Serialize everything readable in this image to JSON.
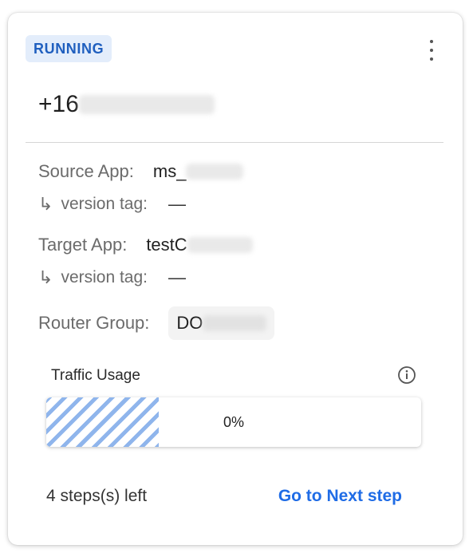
{
  "status": "RUNNING",
  "phone_prefix": "+16",
  "source_app": {
    "label": "Source App:",
    "value_prefix": "ms_"
  },
  "source_version": {
    "label": "version tag:",
    "value": "—"
  },
  "target_app": {
    "label": "Target App:",
    "value_prefix": "testC"
  },
  "target_version": {
    "label": "version tag:",
    "value": "—"
  },
  "router_group": {
    "label": "Router Group:",
    "value_prefix": "DO"
  },
  "traffic": {
    "title": "Traffic Usage",
    "percent_text": "0%",
    "fill_fraction": 0.3
  },
  "footer": {
    "steps_left": "4 steps(s) left",
    "next_label": "Go to Next step"
  },
  "colors": {
    "accent": "#1f6ce6",
    "badge_bg": "#e3edfb",
    "badge_text": "#1f5fbf",
    "stripe": "#8fb5ec"
  },
  "icons": {
    "menu": "more-vert-icon",
    "info": "info-icon",
    "arrow": "subdirectory-arrow-icon"
  }
}
